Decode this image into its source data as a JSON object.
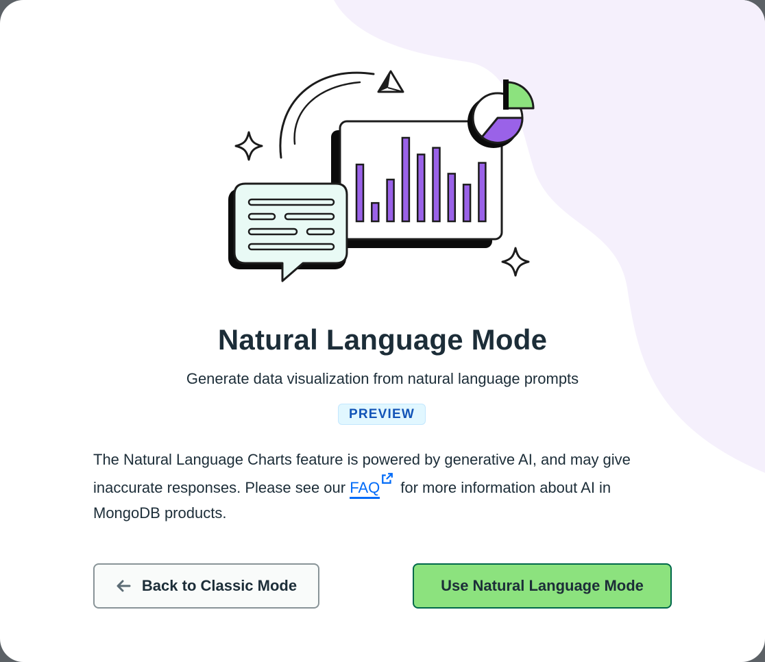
{
  "modal": {
    "title": "Natural Language Mode",
    "subtitle": "Generate data visualization from natural language prompts",
    "badge": "PREVIEW",
    "body_before_link": "The Natural Language Charts feature is powered by generative AI, and may give inaccurate responses. Please see our ",
    "faq_link": "FAQ",
    "body_after_link": "for more information about AI in MongoDB products.",
    "back_button": "Back to Classic Mode",
    "use_button": "Use Natural Language Mode"
  },
  "illustration": {
    "bar_heights_relative": [
      0.68,
      0.22,
      0.5,
      1.0,
      0.8,
      0.88,
      0.57,
      0.44,
      0.7
    ]
  },
  "colors": {
    "accent_green": "#8ce27e",
    "accent_purple": "#9a62e8",
    "link_blue": "#016bf8",
    "blob_lavender": "#f5f0fc"
  }
}
